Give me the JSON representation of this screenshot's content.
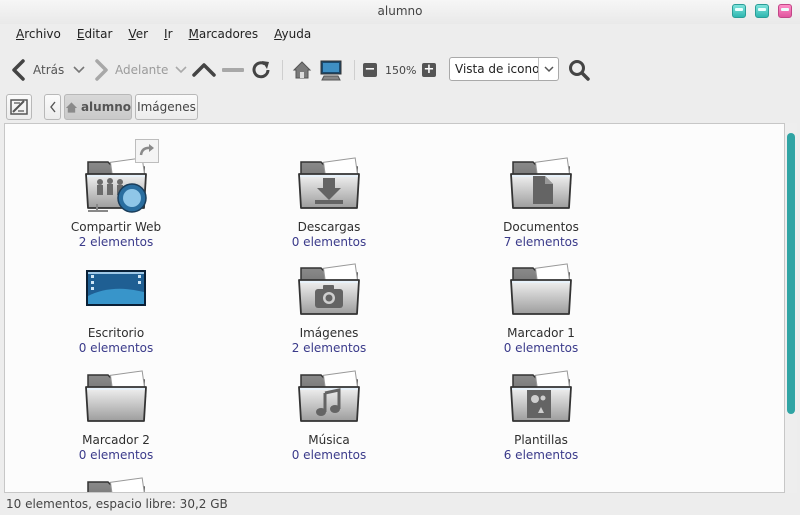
{
  "window": {
    "title": "alumno"
  },
  "menu": [
    {
      "mn": "A",
      "rest": "rchivo"
    },
    {
      "mn": "E",
      "rest": "ditar"
    },
    {
      "mn": "V",
      "rest": "er"
    },
    {
      "mn": "I",
      "rest": "r"
    },
    {
      "mn": "M",
      "rest": "arcadores"
    },
    {
      "mn": "A",
      "rest": "yuda"
    }
  ],
  "toolbar": {
    "back_label": "Atrás",
    "forward_label": "Adelante",
    "zoom_level": "150%",
    "view_mode": "Vista de icono"
  },
  "location": {
    "crumbs": [
      "alumno",
      "Imágenes"
    ]
  },
  "items": [
    {
      "name": "Compartir Web",
      "count": "2 elementos",
      "icon": "web-share-folder-icon"
    },
    {
      "name": "Descargas",
      "count": "0 elementos",
      "icon": "downloads-folder-icon"
    },
    {
      "name": "Documentos",
      "count": "7 elementos",
      "icon": "documents-folder-icon"
    },
    {
      "name": "Escritorio",
      "count": "0 elementos",
      "icon": "desktop-icon"
    },
    {
      "name": "Imágenes",
      "count": "2 elementos",
      "icon": "pictures-folder-icon"
    },
    {
      "name": "Marcador 1",
      "count": "0 elementos",
      "icon": "folder-icon"
    },
    {
      "name": "Marcador 2",
      "count": "0 elementos",
      "icon": "folder-icon"
    },
    {
      "name": "Música",
      "count": "0 elementos",
      "icon": "music-folder-icon"
    },
    {
      "name": "Plantillas",
      "count": "6 elementos",
      "icon": "templates-folder-icon"
    }
  ],
  "status": "10 elementos, espacio libre: 30,2 GB",
  "colors": {
    "accent": "#30a4a4",
    "count_text": "#3a3a8a",
    "close_button": "#e0559e"
  }
}
